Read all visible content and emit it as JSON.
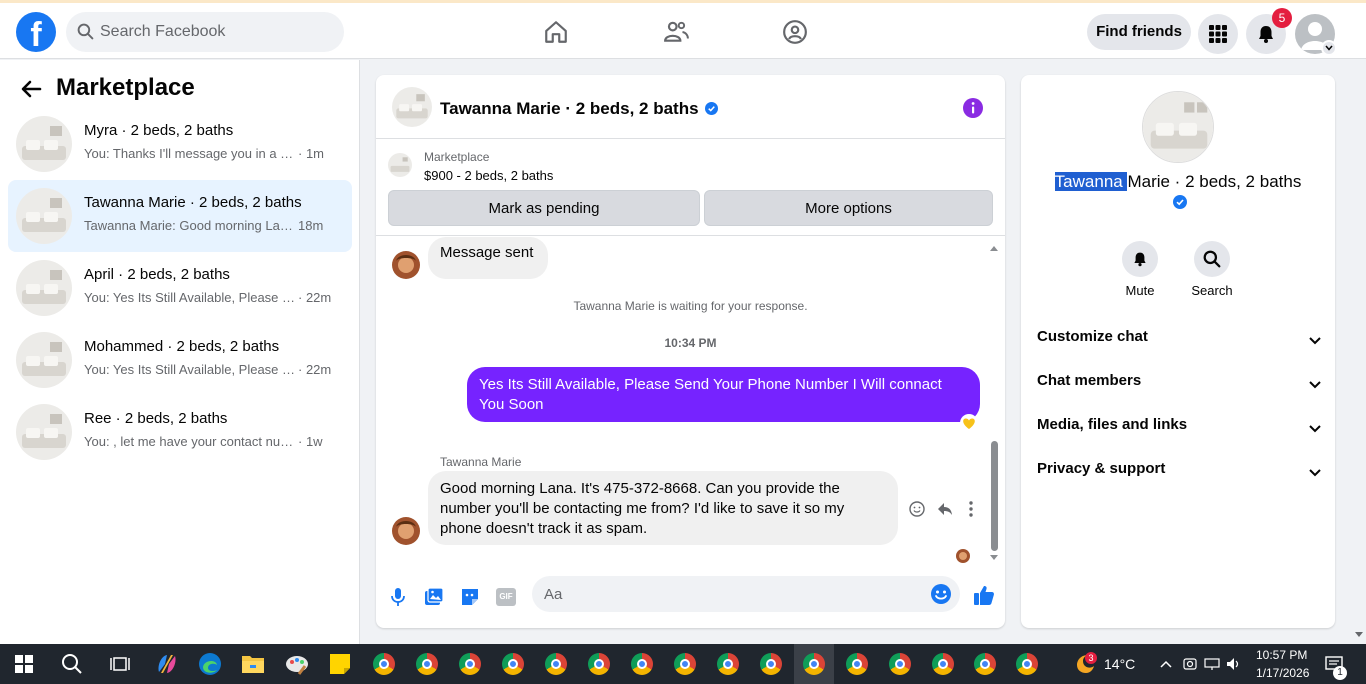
{
  "topbar": {
    "logo": "f",
    "search_placeholder": "Search Facebook",
    "find_friends": "Find friends",
    "notification_count": "5"
  },
  "sidebar": {
    "title": "Marketplace",
    "conversations": [
      {
        "name": "Myra · 2 beds, 2 baths",
        "preview": "You: Thanks I'll message you in a mo...",
        "time": "· 1m"
      },
      {
        "name": "Tawanna Marie · 2 beds, 2 baths",
        "preview": "Tawanna Marie: Good morning Lana...",
        "time": "18m"
      },
      {
        "name": "April · 2 beds, 2 baths",
        "preview": "You: Yes Its Still Available, Please Se...",
        "time": "· 22m"
      },
      {
        "name": "Mohammed · 2 beds, 2 baths",
        "preview": "You: Yes Its Still Available, Please Se...",
        "time": "· 22m"
      },
      {
        "name": "Ree · 2 beds, 2 baths",
        "preview": "You: , let me have your contact numb...",
        "time": "· 1w"
      }
    ]
  },
  "chat": {
    "title": "Tawanna Marie · 2 beds, 2 baths",
    "listing_category": "Marketplace",
    "listing_price": "$900 - 2 beds, 2 baths",
    "mark_pending": "Mark as pending",
    "more_options": "More options",
    "msg_sent": "Message sent",
    "waiting": "Tawanna Marie is waiting for your response.",
    "timestamp": "10:34 PM",
    "outgoing": "Yes Its Still Available, Please Send Your Phone Number I Will connact You Soon",
    "sender_name": "Tawanna Marie",
    "incoming": "Good morning Lana. It's 475-372-8668. Can you provide the number you'll be contacting me from? I'd like to save it so my phone doesn't track it as spam.",
    "composer_placeholder": "Aa",
    "gif_label": "GIF"
  },
  "info": {
    "name_highlight": "Tawanna ",
    "name_rest": "Marie · 2 beds, 2 baths",
    "mute": "Mute",
    "search": "Search",
    "sections": [
      "Customize chat",
      "Chat members",
      "Media, files and links",
      "Privacy & support"
    ]
  },
  "taskbar": {
    "weather_badge": "3",
    "temperature": "14°C",
    "time": "10:57 PM",
    "date": "1/17/2026",
    "notification_count": "1"
  },
  "colors": {
    "brand": "#1877f2",
    "outgoing_bubble": "#7623ff",
    "active_conversation": "#e7f3ff",
    "badge_red": "#e41e3f"
  },
  "icons": [
    "search-icon",
    "home-icon",
    "friends-icon",
    "groups-icon",
    "menu-grid-icon",
    "bell-icon",
    "back-arrow-icon",
    "verified-icon",
    "info-icon",
    "mic-icon",
    "photo-icon",
    "sticker-icon",
    "gif-icon",
    "emoji-icon",
    "thumbs-up-icon",
    "chevron-down-icon",
    "reply-icon",
    "more-icon"
  ]
}
